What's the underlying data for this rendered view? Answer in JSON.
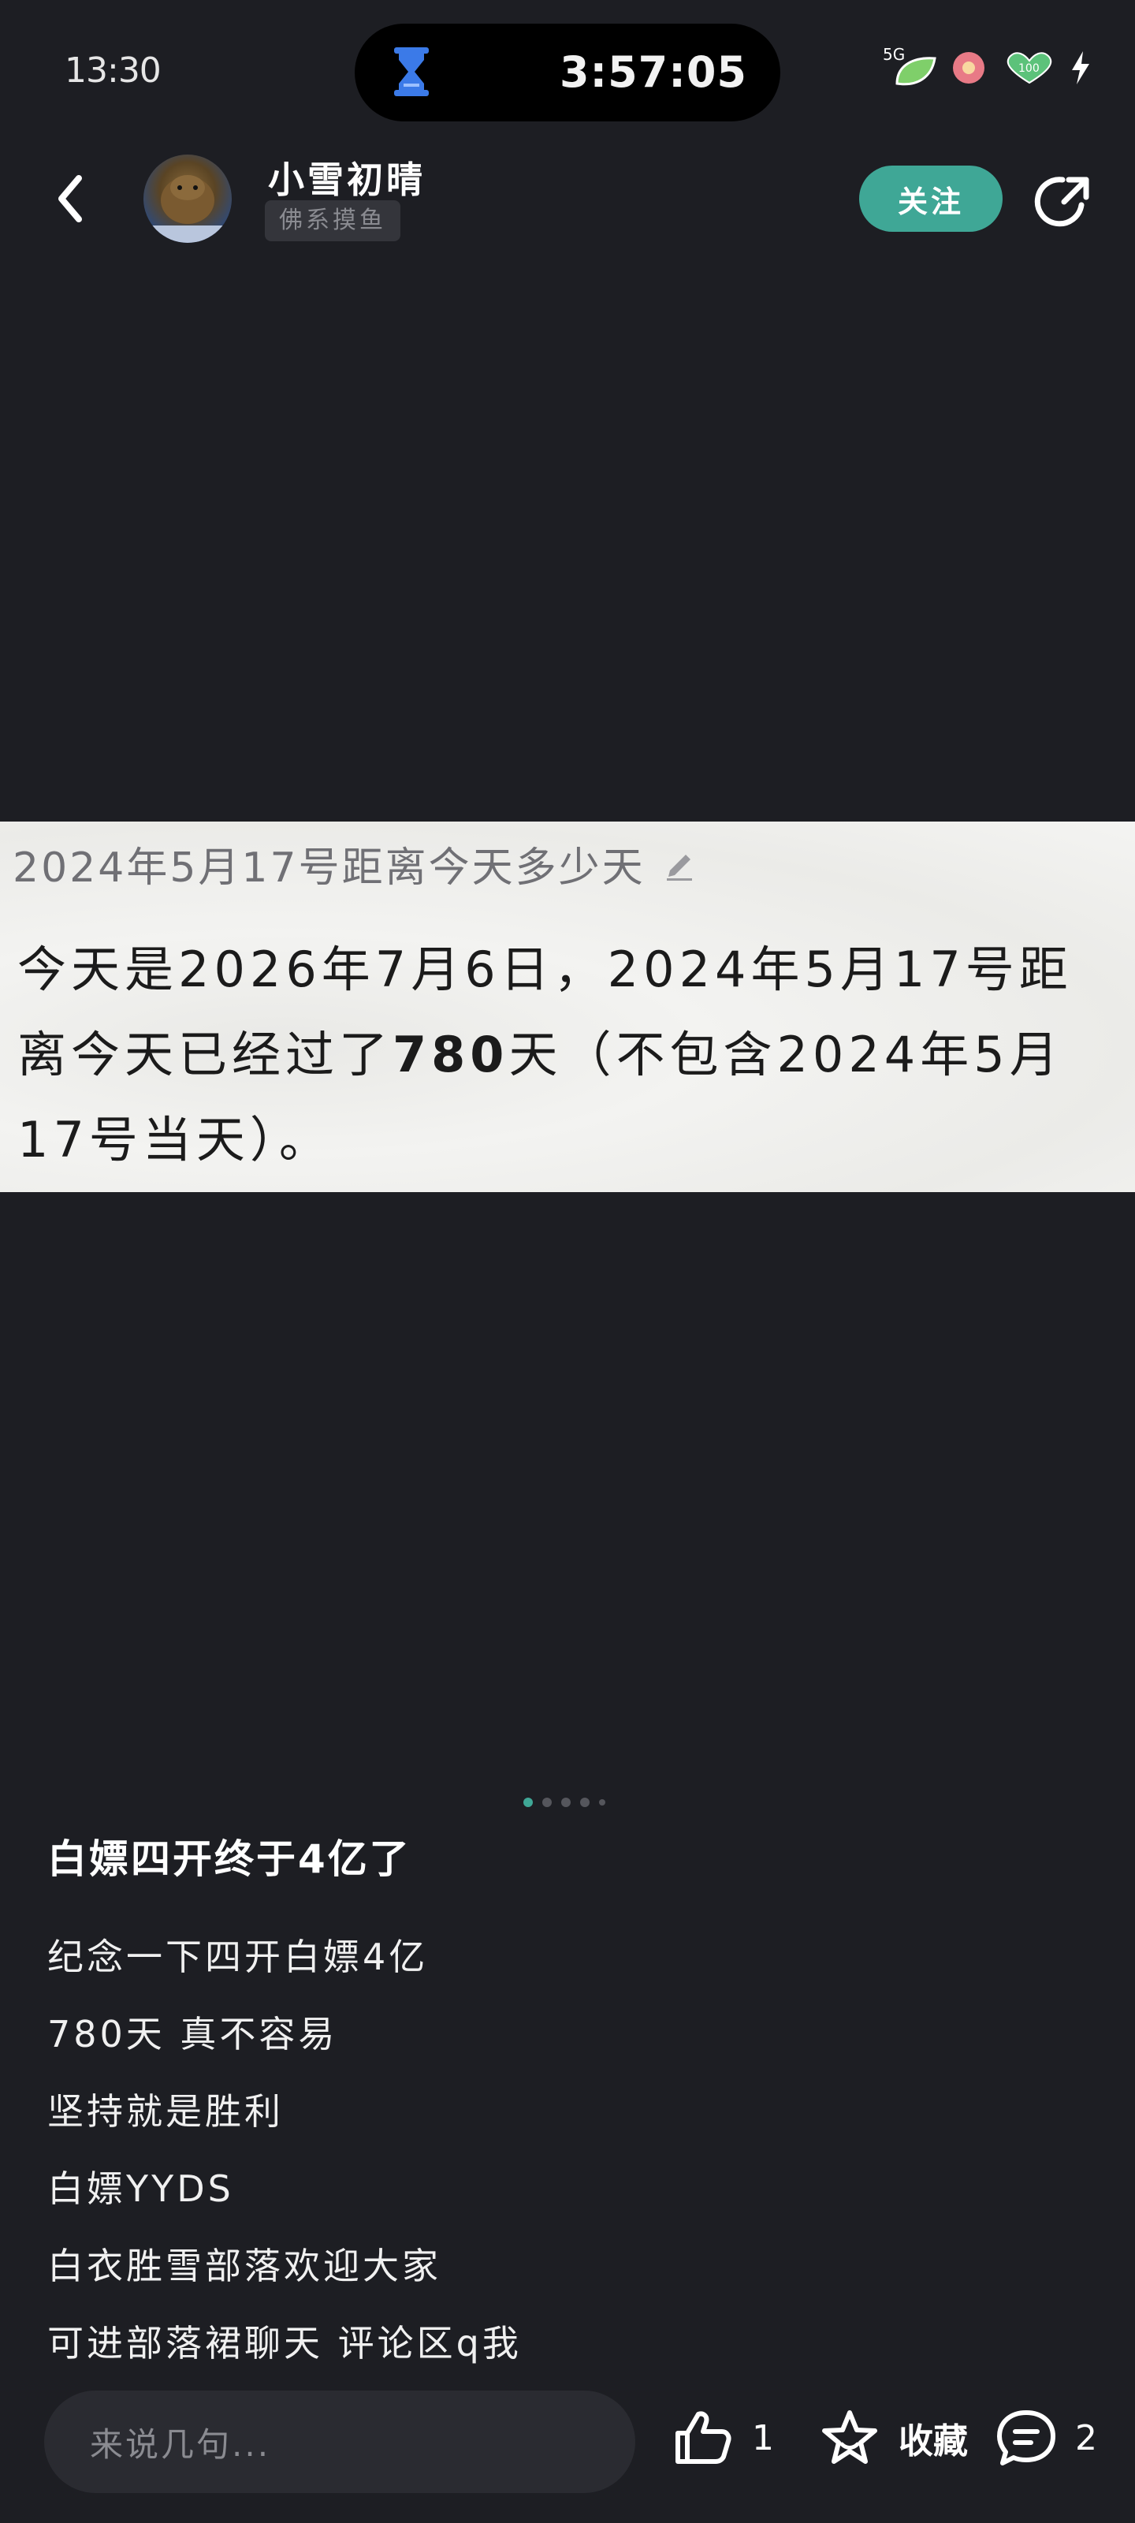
{
  "status_bar": {
    "time": "13:30",
    "timer": "3:57:05",
    "network": "5G"
  },
  "header": {
    "username": "小雪初晴",
    "user_tag": "佛系摸鱼",
    "follow_label": "关注"
  },
  "image_card": {
    "question": "2024年5月17号距离今天多少天",
    "answer_part1": "今天是2026年7月6日，2024年5月17号距离今天已经过了",
    "answer_bold": "780",
    "answer_part2": "天（不包含2024年5月17号当天）。"
  },
  "carousel": {
    "count": 5,
    "active_index": 0
  },
  "post": {
    "title": "白嫖四开终于4亿了",
    "lines": [
      "纪念一下四开白嫖4亿",
      "780天 真不容易",
      "坚持就是胜利",
      "白嫖YYDS",
      "白衣胜雪部落欢迎大家",
      "可进部落裙聊天 评论区q我"
    ]
  },
  "bottom_bar": {
    "comment_placeholder": "来说几句...",
    "like_count": "1",
    "favorite_label": "收藏",
    "comment_count": "2"
  },
  "colors": {
    "background": "#1d1e23",
    "accent": "#3fa796"
  }
}
